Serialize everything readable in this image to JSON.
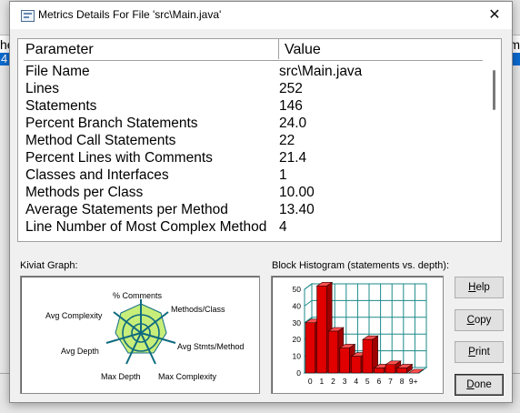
{
  "dialog": {
    "title": "Metrics Details For File 'src\\Main.java'",
    "close_glyph": "✕"
  },
  "table": {
    "headers": {
      "parameter": "Parameter",
      "value": "Value"
    },
    "rows": [
      {
        "parameter": "File Name",
        "value": "src\\Main.java"
      },
      {
        "parameter": "Lines",
        "value": "252"
      },
      {
        "parameter": "Statements",
        "value": "146"
      },
      {
        "parameter": "Percent Branch Statements",
        "value": "24.0"
      },
      {
        "parameter": "Method Call Statements",
        "value": "22"
      },
      {
        "parameter": "Percent Lines with Comments",
        "value": "21.4"
      },
      {
        "parameter": "Classes and Interfaces",
        "value": "1"
      },
      {
        "parameter": "Methods per Class",
        "value": "10.00"
      },
      {
        "parameter": "Average Statements per Method",
        "value": "13.40"
      },
      {
        "parameter": "Line Number of Most Complex Method",
        "value": "4"
      }
    ]
  },
  "kiviat": {
    "label": "Kiviat Graph:",
    "axes": [
      "% Comments",
      "Methods/Class",
      "Avg Stmts/Method",
      "Max Complexity",
      "Max Depth",
      "Avg Depth",
      "Avg Complexity"
    ]
  },
  "histogram": {
    "label": "Block Histogram (statements vs. depth):"
  },
  "chart_data": {
    "type": "bar",
    "title": "Block Histogram (statements vs. depth):",
    "categories": [
      "0",
      "1",
      "2",
      "3",
      "4",
      "5",
      "6",
      "7",
      "8",
      "9+"
    ],
    "values": [
      30,
      52,
      25,
      15,
      10,
      20,
      3,
      5,
      3,
      0
    ],
    "y_ticks": [
      "0",
      "10",
      "20",
      "30",
      "40",
      "50"
    ],
    "ylim": [
      0,
      50
    ],
    "grid": true,
    "bar_color": "#e00000",
    "grid_color": "#1c8a8a"
  },
  "buttons": {
    "help": {
      "pre": "",
      "key": "H",
      "post": "elp"
    },
    "copy": {
      "pre": "",
      "key": "C",
      "post": "opy"
    },
    "print": {
      "pre": "",
      "key": "P",
      "post": "rint"
    },
    "done": {
      "pre": "",
      "key": "D",
      "post": "one"
    }
  },
  "background": {
    "left_fragment": "he",
    "left_row": "4",
    "right_fragment": "m"
  },
  "colors": {
    "selection": "#0b6ad0",
    "kiviat_fill": "#c8ee7a",
    "kiviat_axis": "#0f6b80",
    "bar_red": "#e00000",
    "grid_teal": "#1c8a8a"
  }
}
